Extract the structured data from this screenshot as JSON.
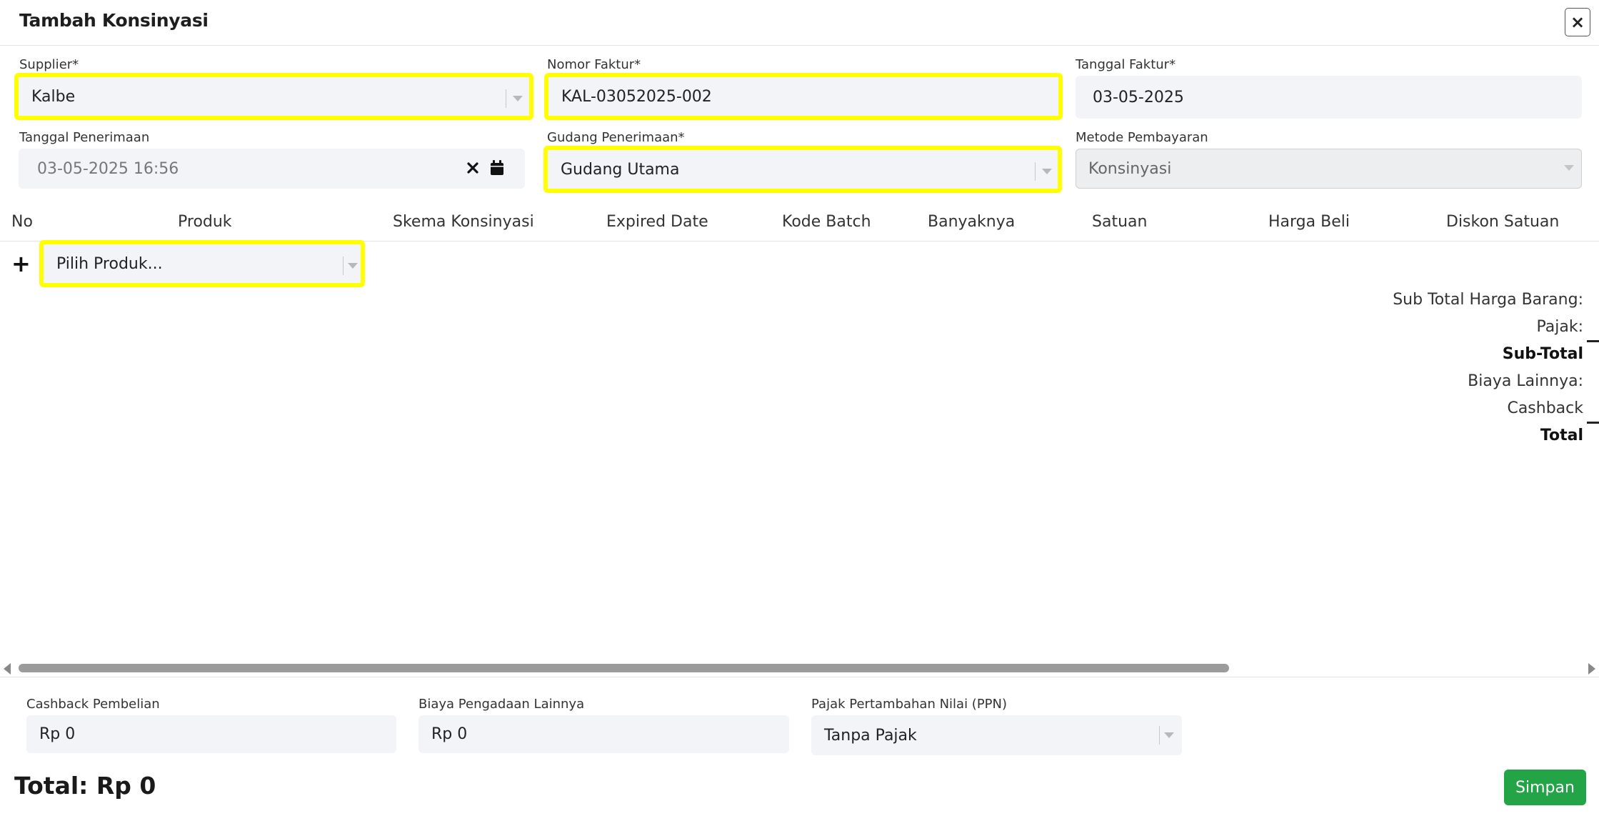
{
  "modal": {
    "title": "Tambah Konsinyasi",
    "close_label": "×"
  },
  "form": {
    "supplier": {
      "label": "Supplier*",
      "value": "Kalbe"
    },
    "nomor_faktur": {
      "label": "Nomor Faktur*",
      "value": "KAL-03052025-002"
    },
    "tanggal_faktur": {
      "label": "Tanggal Faktur*",
      "value": "03-05-2025"
    },
    "tanggal_penerimaan": {
      "label": "Tanggal Penerimaan",
      "value": "03-05-2025 16:56"
    },
    "gudang_penerimaan": {
      "label": "Gudang Penerimaan*",
      "value": "Gudang Utama"
    },
    "metode_pembayaran": {
      "label": "Metode Pembayaran",
      "value": "Konsinyasi"
    }
  },
  "table": {
    "columns": [
      "No",
      "Produk",
      "Skema Konsinyasi",
      "Expired Date",
      "Kode Batch",
      "Banyaknya",
      "Satuan",
      "Harga Beli",
      "Diskon Satuan"
    ],
    "add_label": "+",
    "product_placeholder": "Pilih Produk..."
  },
  "summary": {
    "sub_total_harga_barang": "Sub Total Harga Barang:",
    "pajak": "Pajak:",
    "sub_total": "Sub-Total",
    "biaya_lainnya": "Biaya Lainnya:",
    "cashback": "Cashback",
    "total": "Total"
  },
  "footer": {
    "cashback_pembelian": {
      "label": "Cashback Pembelian",
      "value": "Rp 0"
    },
    "biaya_pengadaan": {
      "label": "Biaya Pengadaan Lainnya",
      "value": "Rp 0"
    },
    "ppn": {
      "label": "Pajak Pertambahan Nilai (PPN)",
      "value": "Tanpa Pajak"
    },
    "total_text": "Total: Rp 0",
    "save_label": "Simpan"
  },
  "colors": {
    "highlight": "#ffff00",
    "save": "#22a447",
    "field_bg": "#f3f4f8"
  },
  "icons": {
    "close": "close-icon",
    "clear": "x-icon",
    "calendar": "calendar-icon",
    "dropdown": "chevron-down-icon",
    "add": "plus-icon"
  }
}
